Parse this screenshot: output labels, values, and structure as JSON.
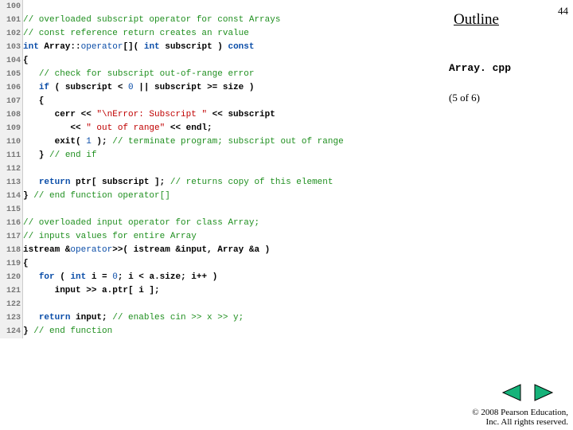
{
  "slide": {
    "outline_label": "Outline",
    "page_number": "44",
    "filename": "Array. cpp",
    "subpage": "(5 of 6)",
    "copyright_line1": "© 2008 Pearson Education,",
    "copyright_line2": "Inc.  All rights reserved."
  },
  "code": {
    "lines": [
      {
        "ln": "100",
        "frags": []
      },
      {
        "ln": "101",
        "frags": [
          {
            "cls": "c",
            "t": "// overloaded subscript operator for const Arrays"
          }
        ]
      },
      {
        "ln": "102",
        "frags": [
          {
            "cls": "c",
            "t": "// const reference return creates an rvalue"
          }
        ]
      },
      {
        "ln": "103",
        "frags": [
          {
            "cls": "k",
            "t": "int "
          },
          {
            "cls": "n",
            "t": "Array::"
          },
          {
            "cls": "kw",
            "t": "operator"
          },
          {
            "cls": "n",
            "t": "[]( "
          },
          {
            "cls": "k",
            "t": "int"
          },
          {
            "cls": "n",
            "t": " subscript ) "
          },
          {
            "cls": "k",
            "t": "const"
          }
        ]
      },
      {
        "ln": "104",
        "frags": [
          {
            "cls": "n",
            "t": "{"
          }
        ]
      },
      {
        "ln": "105",
        "frags": [
          {
            "cls": "p",
            "t": "   "
          },
          {
            "cls": "c",
            "t": "// check for subscript out-of-range error"
          }
        ]
      },
      {
        "ln": "106",
        "frags": [
          {
            "cls": "p",
            "t": "   "
          },
          {
            "cls": "k",
            "t": "if"
          },
          {
            "cls": "n",
            "t": " ( subscript < "
          },
          {
            "cls": "num",
            "t": "0"
          },
          {
            "cls": "n",
            "t": " || subscript >= size )"
          }
        ]
      },
      {
        "ln": "107",
        "frags": [
          {
            "cls": "n",
            "t": "   {"
          }
        ]
      },
      {
        "ln": "108",
        "frags": [
          {
            "cls": "n",
            "t": "      cerr << "
          },
          {
            "cls": "s",
            "t": "\"\\nError: Subscript \""
          },
          {
            "cls": "n",
            "t": " << subscript"
          }
        ]
      },
      {
        "ln": "109",
        "frags": [
          {
            "cls": "n",
            "t": "         << "
          },
          {
            "cls": "s",
            "t": "\" out of range\""
          },
          {
            "cls": "n",
            "t": " << endl;"
          }
        ]
      },
      {
        "ln": "110",
        "frags": [
          {
            "cls": "n",
            "t": "      exit( "
          },
          {
            "cls": "num",
            "t": "1"
          },
          {
            "cls": "n",
            "t": " ); "
          },
          {
            "cls": "c",
            "t": "// terminate program; subscript out of range"
          }
        ]
      },
      {
        "ln": "111",
        "frags": [
          {
            "cls": "n",
            "t": "   } "
          },
          {
            "cls": "c",
            "t": "// end if"
          }
        ]
      },
      {
        "ln": "112",
        "frags": []
      },
      {
        "ln": "113",
        "frags": [
          {
            "cls": "p",
            "t": "   "
          },
          {
            "cls": "k",
            "t": "return"
          },
          {
            "cls": "n",
            "t": " ptr[ subscript ]; "
          },
          {
            "cls": "c",
            "t": "// returns copy of this element"
          }
        ]
      },
      {
        "ln": "114",
        "frags": [
          {
            "cls": "n",
            "t": "} "
          },
          {
            "cls": "c",
            "t": "// end function operator[]"
          }
        ]
      },
      {
        "ln": "115",
        "frags": []
      },
      {
        "ln": "116",
        "frags": [
          {
            "cls": "c",
            "t": "// overloaded input operator for class Array;"
          }
        ]
      },
      {
        "ln": "117",
        "frags": [
          {
            "cls": "c",
            "t": "// inputs values for entire Array"
          }
        ]
      },
      {
        "ln": "118",
        "frags": [
          {
            "cls": "n",
            "t": "istream &"
          },
          {
            "cls": "kw",
            "t": "operator"
          },
          {
            "cls": "n",
            "t": ">>( istream &input, Array &a )"
          }
        ]
      },
      {
        "ln": "119",
        "frags": [
          {
            "cls": "n",
            "t": "{"
          }
        ]
      },
      {
        "ln": "120",
        "frags": [
          {
            "cls": "p",
            "t": "   "
          },
          {
            "cls": "k",
            "t": "for"
          },
          {
            "cls": "n",
            "t": " ( "
          },
          {
            "cls": "k",
            "t": "int"
          },
          {
            "cls": "n",
            "t": " i = "
          },
          {
            "cls": "num",
            "t": "0"
          },
          {
            "cls": "n",
            "t": "; i < a.size; i++ )"
          }
        ]
      },
      {
        "ln": "121",
        "frags": [
          {
            "cls": "n",
            "t": "      input >> a.ptr[ i ];"
          }
        ]
      },
      {
        "ln": "122",
        "frags": []
      },
      {
        "ln": "123",
        "frags": [
          {
            "cls": "p",
            "t": "   "
          },
          {
            "cls": "k",
            "t": "return"
          },
          {
            "cls": "n",
            "t": " input; "
          },
          {
            "cls": "c",
            "t": "// enables cin >> x >> y;"
          }
        ]
      },
      {
        "ln": "124",
        "frags": [
          {
            "cls": "n",
            "t": "} "
          },
          {
            "cls": "c",
            "t": "// end function"
          }
        ]
      }
    ]
  }
}
